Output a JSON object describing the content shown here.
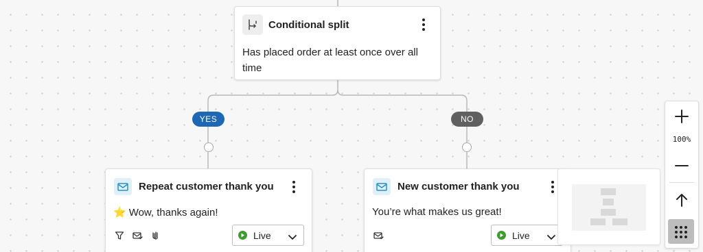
{
  "split_node": {
    "title": "Conditional split",
    "description": "Has placed order at least once over all time",
    "icon": "split-branch-icon"
  },
  "branches": {
    "yes_label": "YES",
    "no_label": "NO",
    "yes_color": "#1e67b3",
    "no_color": "#606060"
  },
  "email_nodes": [
    {
      "title": "Repeat customer thank you",
      "preview_emoji": "⭐",
      "preview": "Wow, thanks again!",
      "status": "Live",
      "icons": [
        "filter-icon",
        "smart-send-icon",
        "utm-tracking-icon"
      ]
    },
    {
      "title": "New customer thank you",
      "preview": "You’re what makes us great!",
      "status": "Live",
      "icons": [
        "smart-send-icon"
      ]
    }
  ],
  "zoom": {
    "level": "100%"
  },
  "colors": {
    "live": "#3f9b2f",
    "email_icon_bg": "#dff0f8",
    "email_icon": "#2a8fc4"
  }
}
